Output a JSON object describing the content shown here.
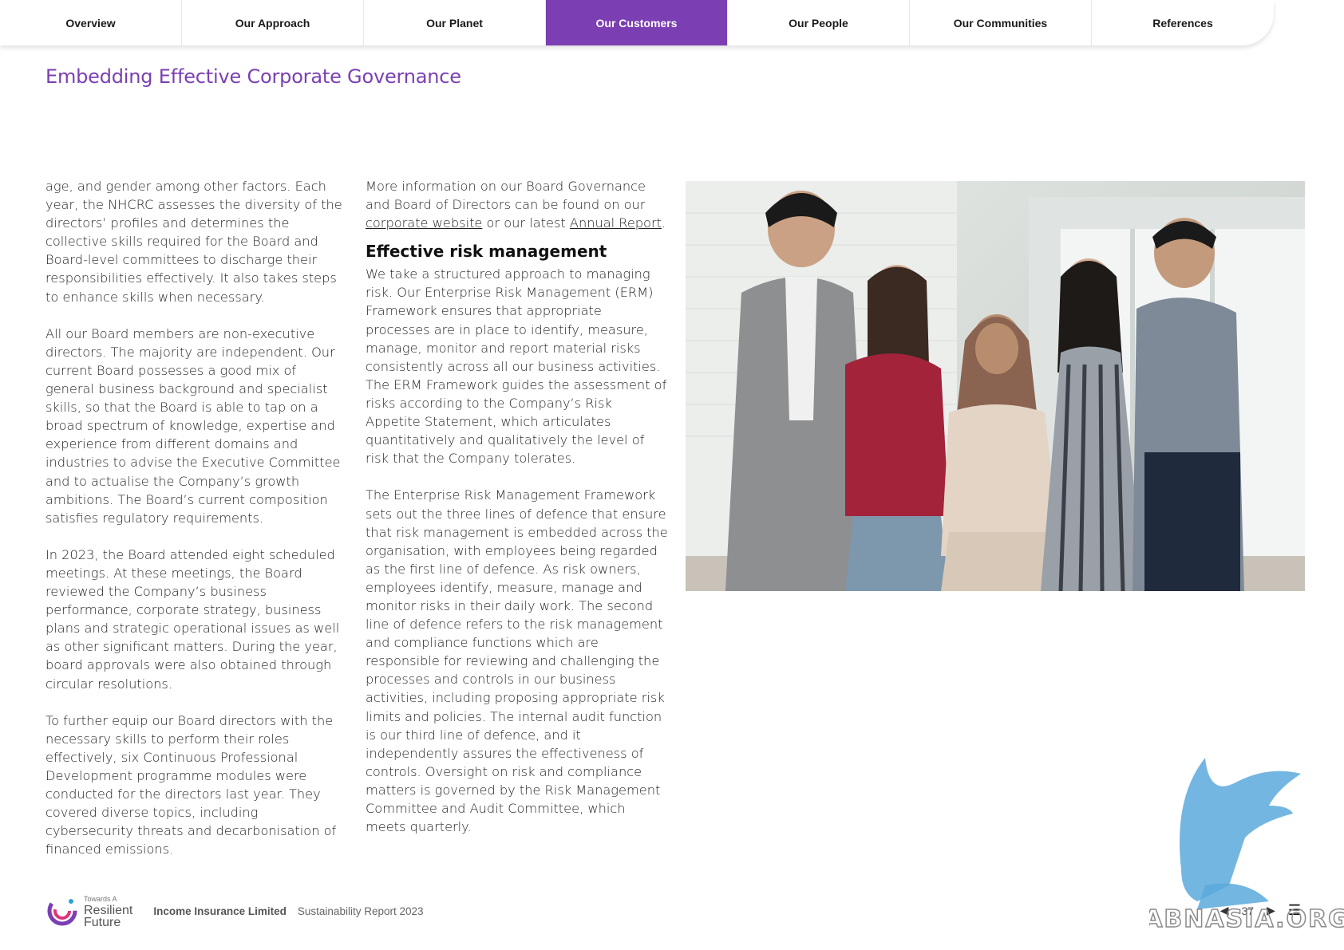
{
  "nav": {
    "tabs": [
      {
        "label": "Overview",
        "active": false
      },
      {
        "label": "Our Approach",
        "active": false
      },
      {
        "label": "Our Planet",
        "active": false
      },
      {
        "label": "Our Customers",
        "active": true
      },
      {
        "label": "Our People",
        "active": false
      },
      {
        "label": "Our Communities",
        "active": false
      },
      {
        "label": "References",
        "active": false
      }
    ]
  },
  "page": {
    "title": "Embedding Effective Corporate Governance"
  },
  "column1": {
    "paragraphs": [
      "age, and gender among other factors. Each year, the NHCRC assesses the diversity of the directors’ profiles and determines the collective skills required for the Board and Board-level committees to discharge their responsibilities effectively. It also takes steps to enhance skills when necessary.",
      "All our Board members are non-executive directors. The majority are independent. Our current Board possesses a good mix of general business background and specialist skills, so that the Board is able to tap on a broad spectrum of knowledge, expertise and experience from different domains and industries to advise the Executive Committee and to actualise the Company’s growth ambitions. The Board’s current composition satisfies regulatory requirements.",
      "In 2023, the Board attended eight scheduled meetings. At these meetings, the Board reviewed the Company’s business performance, corporate strategy, business plans and strategic operational issues as well as other significant matters. During the year, board approvals were also obtained through circular resolutions.",
      "To further equip our Board directors with the necessary skills to perform their roles effectively, six Continuous Professional Development programme modules were conducted for the directors last year. They covered diverse topics, including cybersecurity threats and decarbonisation of financed emissions."
    ]
  },
  "column2": {
    "intro_before": "More information on our Board Governance and Board of Directors can be found on our",
    "link_website": "corporate website",
    "intro_middle": "or our latest",
    "link_annual": "Annual Report",
    "intro_after": ".",
    "heading": "Effective risk management",
    "paragraphs": [
      "We take a structured approach to managing risk. Our Enterprise Risk Management (ERM) Framework ensures that appropriate processes are in place to identify, measure, manage, monitor and report material risks consistently across all our business activities. The ERM Framework guides the assessment of risks according to the Company’s Risk Appetite Statement, which articulates quantitatively and qualitatively the level of risk that the Company tolerates.",
      "The Enterprise Risk Management Framework sets out the three lines of defence that ensure that risk management is embedded across the organisation, with employees being regarded as the first line of defence. As risk owners, employees identify, measure, manage and monitor risks in their daily work. The second line of defence refers to the risk management and compliance functions which are responsible for reviewing and challenging the processes and controls in our business activities, including proposing appropriate risk limits and policies. The internal audit function is our third line of defence, and it independently assures the effectiveness of controls. Oversight on risk and compliance matters is governed by the Risk Management Committee and Audit Committee, which meets quarterly."
    ]
  },
  "footer": {
    "logo_small": "Towards A",
    "logo_line1": "Resilient",
    "logo_line2": "Future",
    "company": "Income Insurance Limited",
    "report": "Sustainability Report 2023",
    "page_number": "37"
  },
  "watermark": {
    "text": "ABNASIA.ORG"
  },
  "colors": {
    "accent": "#7b3fb3",
    "watermark": "#5aa9dc"
  }
}
